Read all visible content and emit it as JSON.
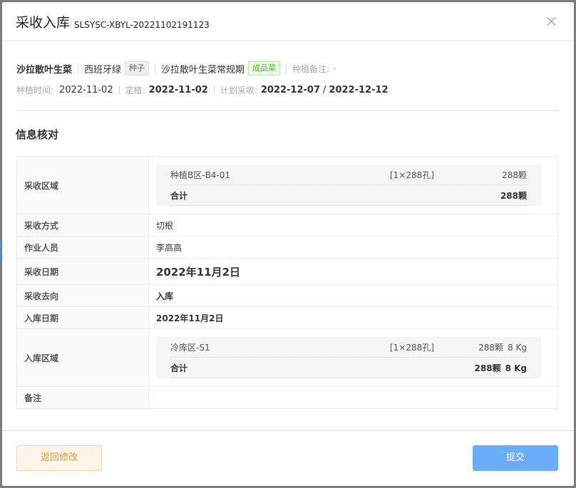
{
  "dialog": {
    "title": "采收入库",
    "order_no": "SLSYSC-XBYL-20221102191123"
  },
  "product": {
    "name": "沙拉散叶生菜",
    "variety": "西班牙绿",
    "variety_tag": "种子",
    "spec": "沙拉散叶生菜常规期",
    "spec_tag": "成品菜",
    "remark_label": "种植备注:",
    "remark_value": "-"
  },
  "dates": {
    "plant_label": "种植时间:",
    "plant_value": "2022-11-02",
    "fix_label": "定植:",
    "fix_value": "2022-11-02",
    "plan_label": "计划采收:",
    "plan_from": "2022-12-07",
    "plan_sep": "/",
    "plan_to": "2022-12-12"
  },
  "section_title": "信息核对",
  "info": {
    "harvest_area_label": "采收区域",
    "harvest_area": {
      "rows": [
        {
          "name": "种植B区-B4-01",
          "spec": "[1×288孔]",
          "qty": "288颗"
        }
      ],
      "total": {
        "label": "合计",
        "qty": "288颗"
      }
    },
    "method_label": "采收方式",
    "method_value": "切根",
    "worker_label": "作业人员",
    "worker_value": "李高高",
    "harvest_date_label": "采收日期",
    "harvest_date_value": "2022年11月2日",
    "destination_label": "采收去向",
    "destination_value": "入库",
    "store_date_label": "入库日期",
    "store_date_value": "2022年11月2日",
    "store_area_label": "入库区域",
    "store_area": {
      "rows": [
        {
          "name": "冷库区-S1",
          "spec": "[1×288孔]",
          "qty": "288颗",
          "weight": "8 Kg"
        }
      ],
      "total": {
        "label": "合计",
        "qty": "288颗",
        "weight": "8 Kg"
      }
    },
    "note_label": "备注",
    "note_value": ""
  },
  "buttons": {
    "back": "返回修改",
    "submit": "提交"
  }
}
